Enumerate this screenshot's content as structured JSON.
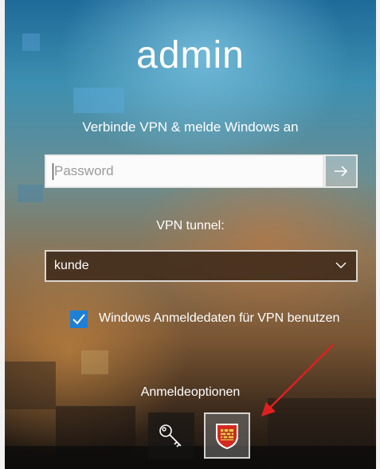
{
  "user": {
    "name": "admin"
  },
  "login": {
    "subtitle": "Verbinde VPN & melde Windows an",
    "password_placeholder": "Password",
    "submit_icon": "arrow-right-icon"
  },
  "vpn": {
    "tunnel_label": "VPN tunnel:",
    "selected_tunnel": "kunde"
  },
  "checkbox": {
    "checked": true,
    "label": "Windows Anmeldedaten für VPN benutzen"
  },
  "options": {
    "label": "Anmeldeoptionen",
    "items": [
      {
        "icon": "key-icon"
      },
      {
        "icon": "vpn-shield-icon"
      }
    ]
  },
  "colors": {
    "accent": "#1e7fd6",
    "vpn_icon_red": "#d42a20",
    "annotation_arrow": "#e02020"
  }
}
